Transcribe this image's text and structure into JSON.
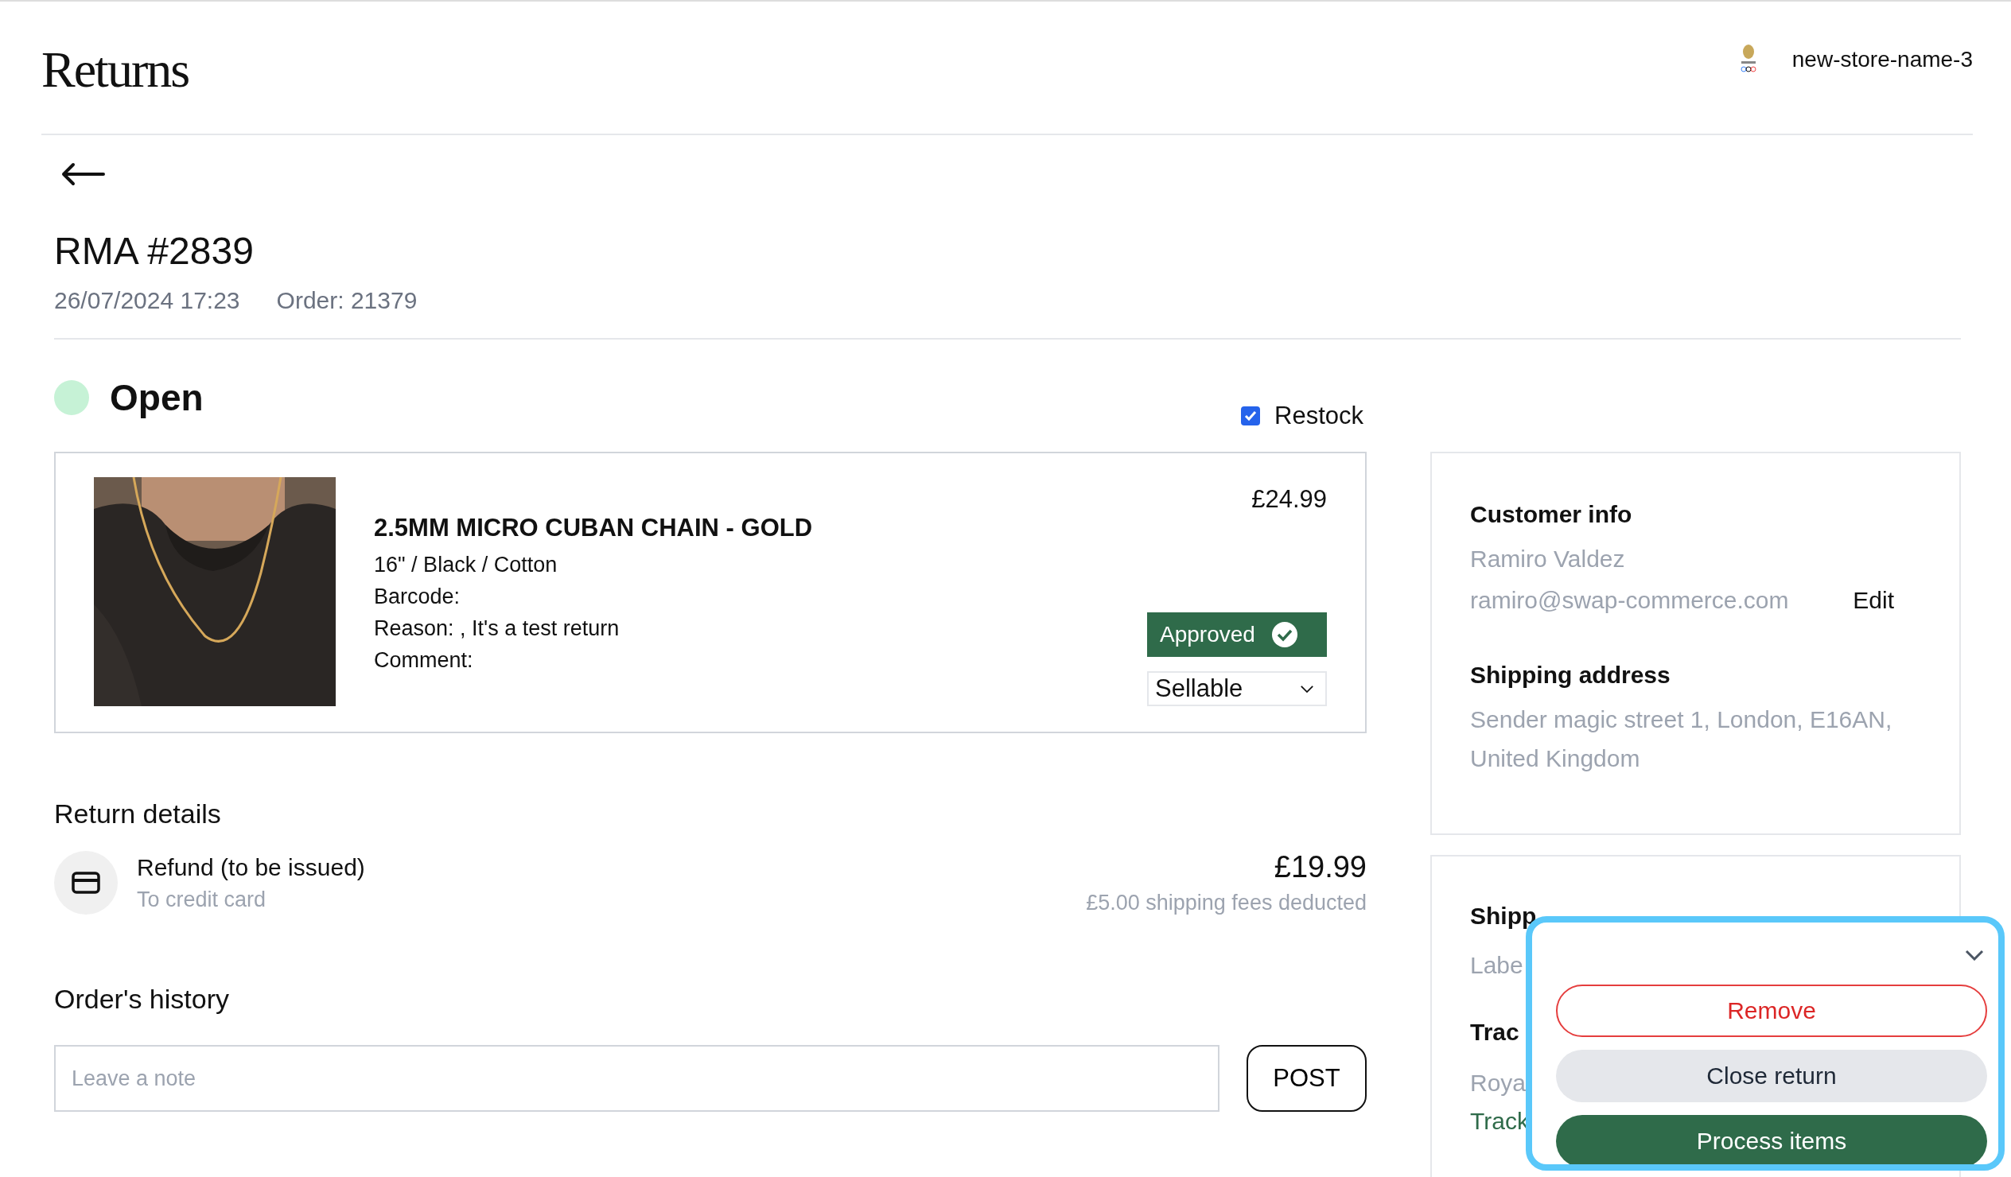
{
  "header": {
    "title": "Returns",
    "store_name": "new-store-name-3"
  },
  "rma": {
    "title": "RMA #2839",
    "date": "26/07/2024 17:23",
    "order": "Order: 21379"
  },
  "status": {
    "label": "Open"
  },
  "restock": {
    "label": "Restock",
    "checked": true
  },
  "items": [
    {
      "title": "2.5MM MICRO CUBAN CHAIN - GOLD",
      "variant": "16\" / Black / Cotton",
      "barcode": "Barcode:",
      "reason": "Reason: , It's a test return",
      "comment": "Comment:",
      "price": "£24.99",
      "approved": true,
      "approval_label": "Approved",
      "condition": "Sellable"
    }
  ],
  "return_details": {
    "heading": "Return details",
    "refund": {
      "title": "Refund (to be issued)",
      "method": "To credit card",
      "amount": "£19.99",
      "note": "£5.00 shipping fees deducted"
    }
  },
  "history": {
    "heading": "Order's history",
    "placeholder": "Leave a note",
    "post": "POST"
  },
  "customer": {
    "heading": "Customer info",
    "name": "Ramiro Valdez",
    "email": "ramiro@swap-commerce.com",
    "edit": "Edit",
    "address_heading": "Shipping address",
    "address": "Sender magic street 1, London, E16AN, United Kingdom"
  },
  "shipping": {
    "heading": "Shipp",
    "label": "Labe",
    "tracking_heading": "Trac",
    "carrier": "Roya",
    "tracking_link": "Track"
  },
  "actions_menu": {
    "buttons": [
      {
        "label": "Remove",
        "kind": "danger"
      },
      {
        "label": "Close return",
        "kind": "secondary"
      },
      {
        "label": "Process items",
        "kind": "primary"
      }
    ]
  }
}
